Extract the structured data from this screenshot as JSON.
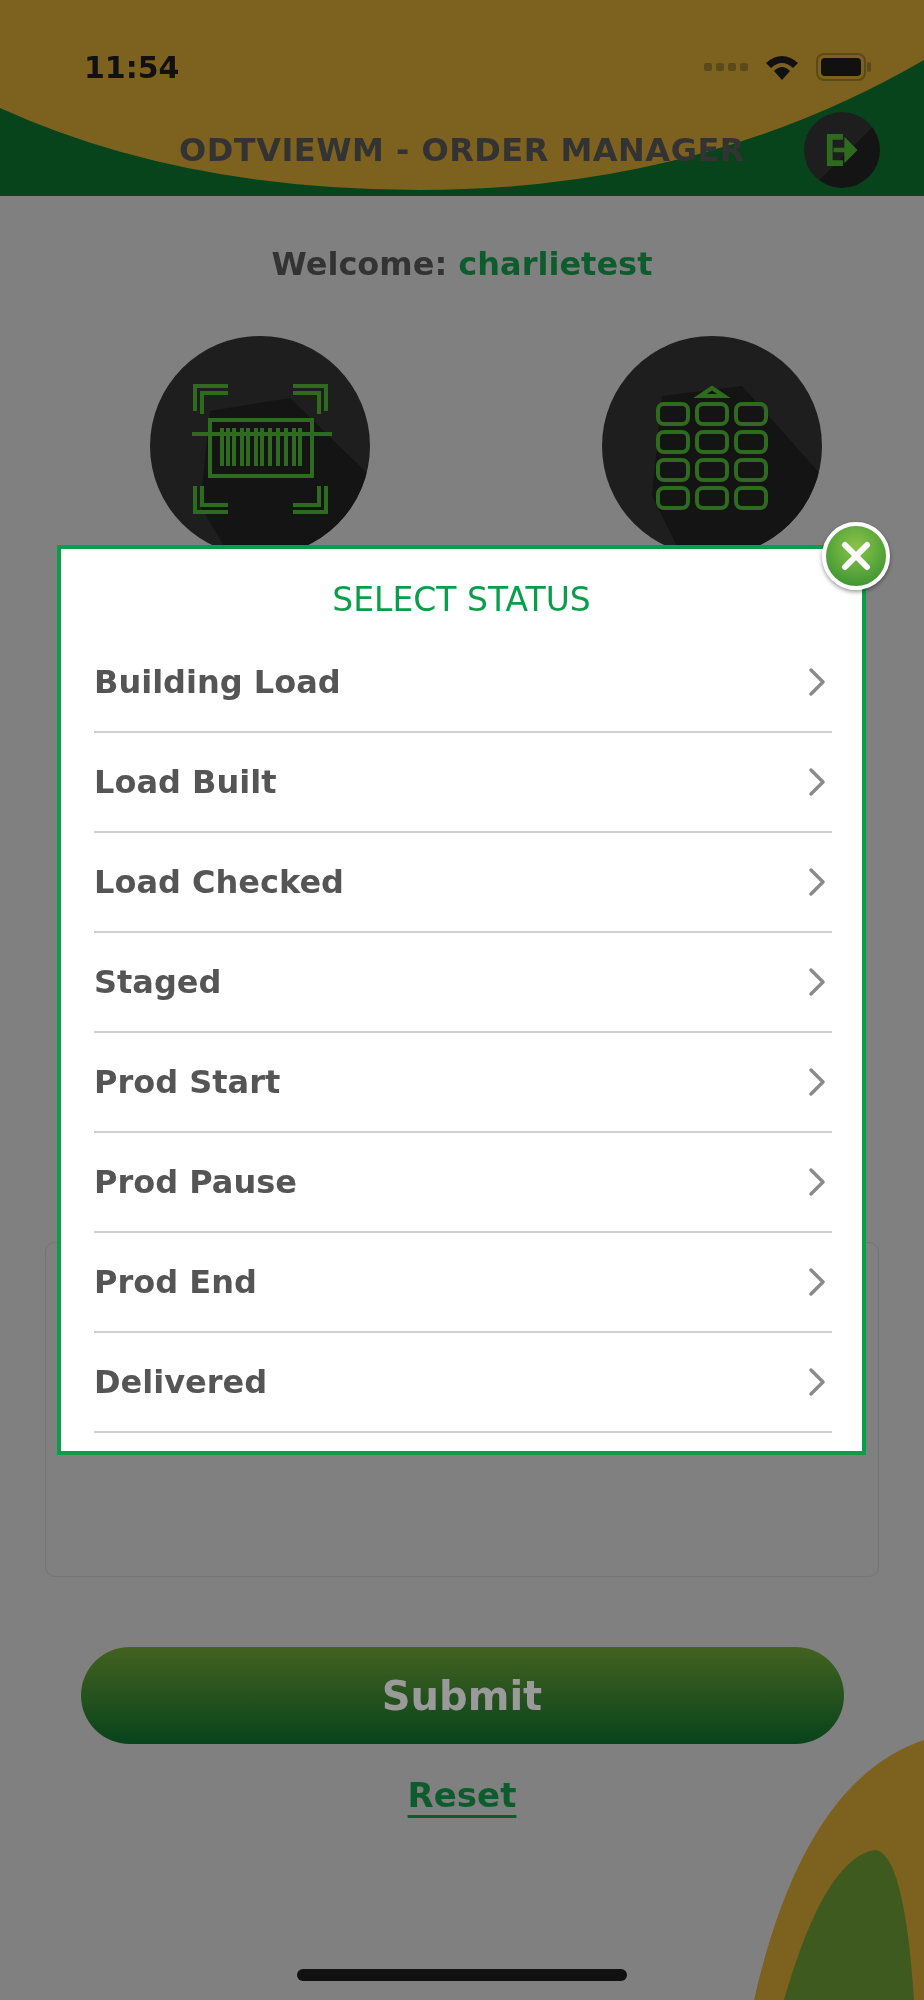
{
  "status_bar": {
    "time": "11:54"
  },
  "header": {
    "title": "ODTVIEWM - ORDER MANAGER"
  },
  "welcome": {
    "label": "Welcome:",
    "user": "charlietest"
  },
  "actions": {
    "submit": "Submit",
    "reset": "Reset"
  },
  "modal": {
    "title": "SELECT STATUS",
    "options": [
      {
        "label": "Building Load"
      },
      {
        "label": "Load Built"
      },
      {
        "label": "Load Checked"
      },
      {
        "label": "Staged"
      },
      {
        "label": "Prod Start"
      },
      {
        "label": "Prod Pause"
      },
      {
        "label": "Prod End"
      },
      {
        "label": "Delivered"
      }
    ]
  }
}
